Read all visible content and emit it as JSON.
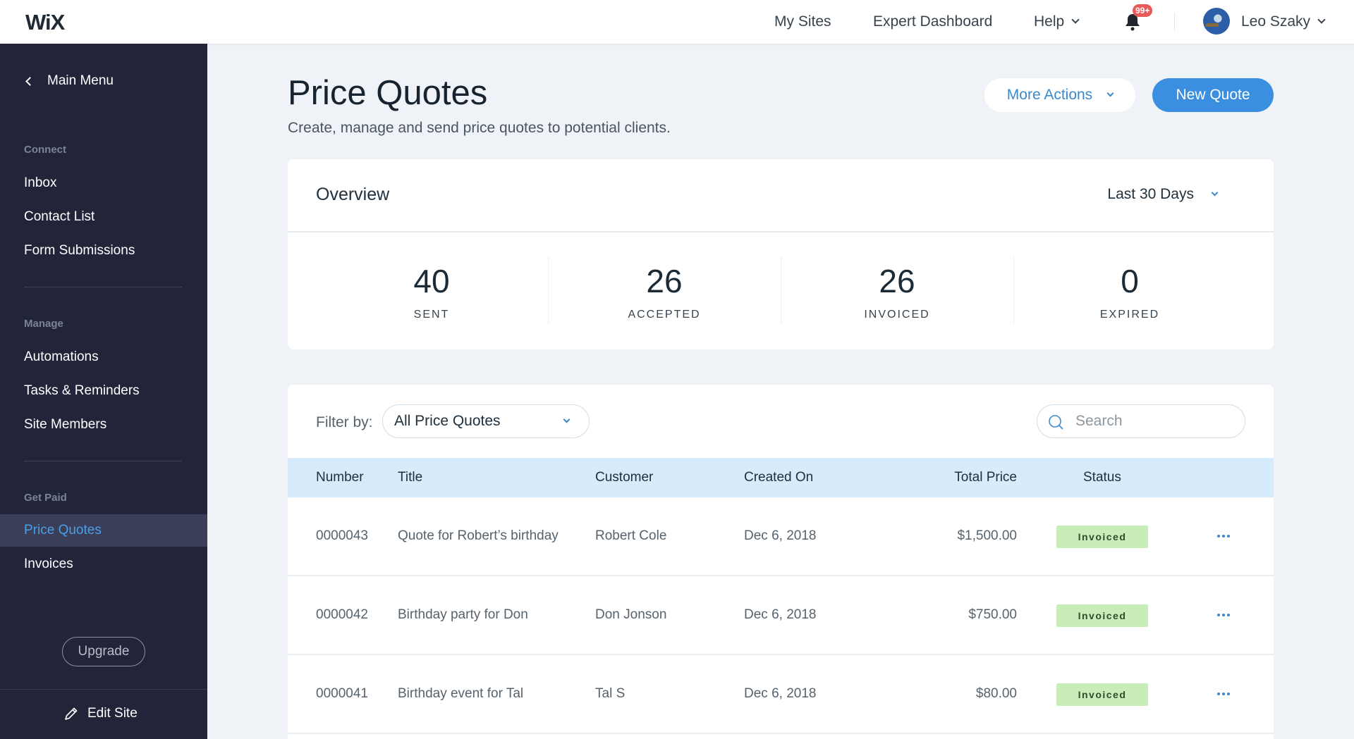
{
  "topbar": {
    "logo": "WiX",
    "nav": [
      "My Sites",
      "Expert Dashboard",
      "Help"
    ],
    "notifications_badge": "99+",
    "user_name": "Leo Szaky"
  },
  "sidebar": {
    "main_menu": "Main Menu",
    "sections": [
      {
        "label": "Connect",
        "items": [
          "Inbox",
          "Contact List",
          "Form Submissions"
        ]
      },
      {
        "label": "Manage",
        "items": [
          "Automations",
          "Tasks & Reminders",
          "Site Members"
        ]
      },
      {
        "label": "Get Paid",
        "items": [
          "Price Quotes",
          "Invoices"
        ]
      }
    ],
    "active_item": "Price Quotes",
    "upgrade": "Upgrade",
    "edit_site": "Edit Site"
  },
  "header": {
    "title": "Price Quotes",
    "subtitle": "Create, manage and send price quotes to potential clients.",
    "more_actions": "More Actions",
    "new_quote": "New Quote"
  },
  "overview": {
    "title": "Overview",
    "period": "Last 30 Days",
    "stats": [
      {
        "value": "40",
        "label": "SENT"
      },
      {
        "value": "26",
        "label": "ACCEPTED"
      },
      {
        "value": "26",
        "label": "INVOICED"
      },
      {
        "value": "0",
        "label": "EXPIRED"
      }
    ]
  },
  "table": {
    "filter_label": "Filter by:",
    "filter_value": "All Price Quotes",
    "search_placeholder": "Search",
    "columns": [
      "Number",
      "Title",
      "Customer",
      "Created On",
      "Total Price",
      "Status"
    ],
    "rows": [
      {
        "number": "0000043",
        "title": "Quote for Robert’s birthday",
        "customer": "Robert Cole",
        "created": "Dec 6, 2018",
        "total": "$1,500.00",
        "status": "Invoiced"
      },
      {
        "number": "0000042",
        "title": "Birthday party for Don",
        "customer": "Don Jonson",
        "created": "Dec 6, 2018",
        "total": "$750.00",
        "status": "Invoiced"
      },
      {
        "number": "0000041",
        "title": "Birthday event for Tal",
        "customer": "Tal S",
        "created": "Dec 6, 2018",
        "total": "$80.00",
        "status": "Invoiced"
      }
    ]
  },
  "colors": {
    "sidebar_bg": "#22243a",
    "accent_blue": "#3a8fe1",
    "badge_red": "#e85a5a",
    "status_invoiced_bg": "#c9edb9",
    "table_header_bg": "#d6ebfb"
  }
}
